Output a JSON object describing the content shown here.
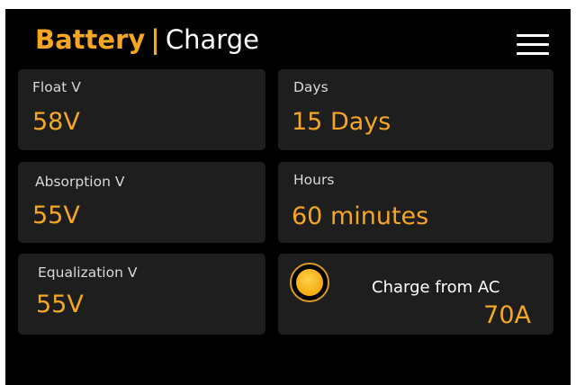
{
  "header": {
    "title_primary": "Battery",
    "separator": "|",
    "title_page": "Charge",
    "menu_icon": "hamburger-menu-icon"
  },
  "tiles": {
    "float": {
      "label": "Float V",
      "value": "58V"
    },
    "days": {
      "label": "Days",
      "value": "15 Days"
    },
    "absorption": {
      "label": "Absorption V",
      "value": "55V"
    },
    "hours": {
      "label": "Hours",
      "value": "60 minutes"
    },
    "equalization": {
      "label": "Equalization V",
      "value": "55V"
    },
    "charge_ac": {
      "label": "Charge from AC",
      "value": "70A",
      "icon": "sun-indicator-icon"
    }
  },
  "colors": {
    "background": "#000000",
    "tile": "#1e1e1e",
    "accent": "#f5a623",
    "label": "#d9d9d9",
    "text": "#ffffff"
  }
}
